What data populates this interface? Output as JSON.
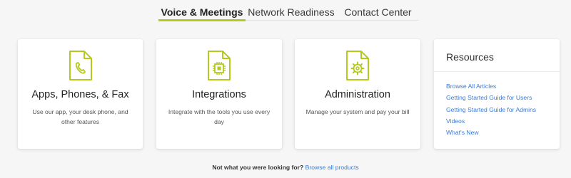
{
  "tabs": [
    {
      "label": "Voice & Meetings",
      "active": true
    },
    {
      "label": "Network Readiness",
      "active": false
    },
    {
      "label": "Contact Center",
      "active": false
    }
  ],
  "colors": {
    "accent": "#b5c91d",
    "link": "#3a7ad6"
  },
  "cards": [
    {
      "icon": "phone-document-icon",
      "title": "Apps, Phones, & Fax",
      "description": "Use our app, your desk phone, and other features"
    },
    {
      "icon": "chip-document-icon",
      "title": "Integrations",
      "description": "Integrate with the tools you use every day"
    },
    {
      "icon": "gear-document-icon",
      "title": "Administration",
      "description": "Manage your system and pay your bill"
    }
  ],
  "resources": {
    "title": "Resources",
    "links": [
      "Browse All Articles",
      "Getting Started Guide for Users",
      "Getting Started Guide for Admins",
      "Videos",
      "What's New"
    ]
  },
  "footer": {
    "question": "Not what you were looking for?",
    "link": "Browse all products"
  }
}
